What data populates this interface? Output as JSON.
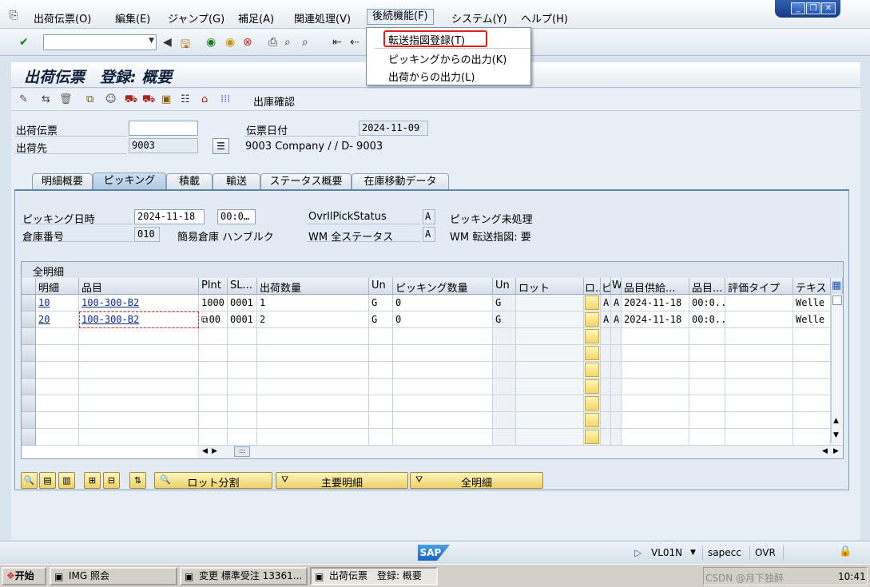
{
  "menubar": {
    "items": [
      "出荷伝票(O)",
      "編集(E)",
      "ジャンプ(G)",
      "補足(A)",
      "関連処理(V)",
      "後続機能(F)",
      "システム(Y)",
      "ヘルプ(H)"
    ]
  },
  "dropdown": {
    "items": [
      "転送指図登録(T)",
      "ピッキングからの出力(K)",
      "出荷からの出力(L)"
    ]
  },
  "title": "出荷伝票　登録: 概要",
  "apptoolbar": {
    "label": "出庫確認"
  },
  "header": {
    "delivery_label": "出荷伝票",
    "delivery_value": "",
    "shipto_label": "出荷先",
    "shipto_value": "9003",
    "shipto_desc": "9003 Company / / D- 9003",
    "docdate_label": "伝票日付",
    "docdate_value": "2024-11-09"
  },
  "tabs": [
    "明細概要",
    "ピッキング",
    "積載",
    "輸送",
    "ステータス概要",
    "在庫移動データ"
  ],
  "picking": {
    "date_label": "ピッキング日時",
    "date_value": "2024-11-18",
    "time_value": "00:0…",
    "status_label": "OvrllPickStatus",
    "status_value": "A",
    "status_text": "ピッキング未処理",
    "whse_label": "倉庫番号",
    "whse_value": "010",
    "whse_text": "簡易倉庫 ハンブルク",
    "wm_label": "WM 全ステータス",
    "wm_value": "A",
    "wm_text": "WM 転送指図: 要"
  },
  "table": {
    "title": "全明細",
    "columns": [
      "明細",
      "品目",
      "Plnt",
      "SL...",
      "出荷数量",
      "Un",
      "ピッキング数量",
      "Un",
      "ロット",
      "ロ..",
      "ピ",
      "W",
      "品目供給...",
      "品目...",
      "評価タイプ",
      "テキスト"
    ],
    "rows": [
      [
        "10",
        "100-300-B2",
        "1000",
        "0001",
        "1",
        "G",
        "0",
        "G",
        "",
        "",
        "A",
        "A",
        "2024-11-18",
        "00:0...",
        "",
        "Welle"
      ],
      [
        "20",
        "100-300-B2",
        "00",
        "0001",
        "2",
        "G",
        "0",
        "G",
        "",
        "",
        "A",
        "A",
        "2024-11-18",
        "00:0...",
        "",
        "Welle"
      ]
    ]
  },
  "buttons": {
    "batch_split": "ロット分割",
    "main_items": "主要明細",
    "all_items": "全明細"
  },
  "status": {
    "transaction": "VL01N",
    "system": "sapecc",
    "mode": "OVR",
    "logo": "SAP"
  },
  "taskbar": {
    "start": "开始",
    "tasks": [
      "IMG 照会",
      "変更 標準受注 13361...",
      "出荷伝票　登録: 概要"
    ],
    "clock": "10:41",
    "tray_text": "CSDN @月下独醉"
  }
}
